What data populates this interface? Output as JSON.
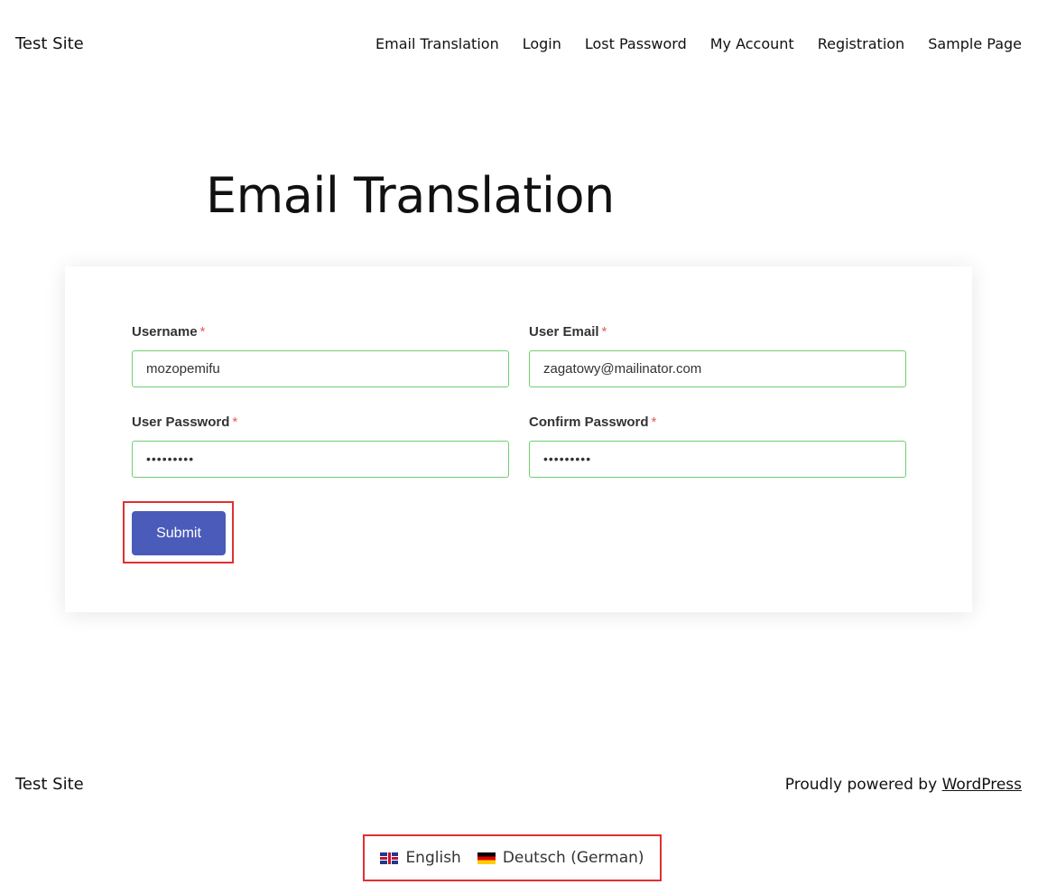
{
  "header": {
    "site_title": "Test Site",
    "nav": [
      {
        "label": "Email Translation"
      },
      {
        "label": "Login"
      },
      {
        "label": "Lost Password"
      },
      {
        "label": "My Account"
      },
      {
        "label": "Registration"
      },
      {
        "label": "Sample Page"
      }
    ]
  },
  "page_title": "Email Translation",
  "form": {
    "required_mark": "*",
    "username": {
      "label": "Username",
      "value": "mozopemifu"
    },
    "email": {
      "label": "User Email",
      "value": "zagatowy@mailinator.com"
    },
    "password": {
      "label": "User Password",
      "value": "•••••••••"
    },
    "confirm_password": {
      "label": "Confirm Password",
      "value": "•••••••••"
    },
    "submit_label": "Submit"
  },
  "footer": {
    "site_title": "Test Site",
    "powered_prefix": "Proudly powered by ",
    "powered_link": "WordPress",
    "languages": [
      {
        "label": "English",
        "icon": "uk-flag-icon"
      },
      {
        "label": "Deutsch (German)",
        "icon": "germany-flag-icon"
      }
    ]
  },
  "colors": {
    "accent": "#4a5bb9",
    "input_border": "#6fcf6f",
    "highlight_box": "#e03030",
    "required": "#e35b5b"
  }
}
